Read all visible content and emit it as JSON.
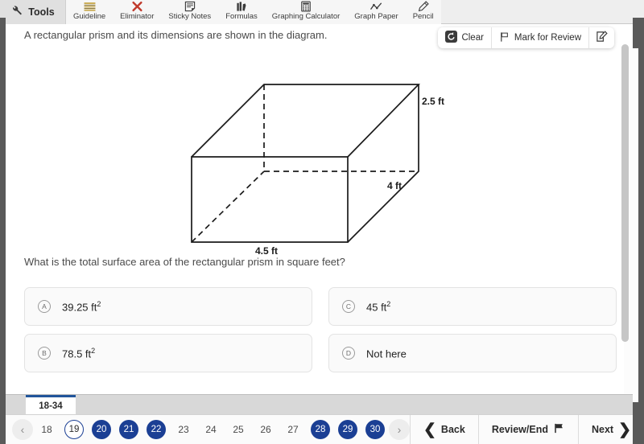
{
  "toolbar": {
    "tools_label": "Tools",
    "tools_icon": "wrench-icon",
    "items": [
      {
        "label": "Guideline",
        "icon": "guideline-icon"
      },
      {
        "label": "Eliminator",
        "icon": "eliminator-x-icon"
      },
      {
        "label": "Sticky Notes",
        "icon": "sticky-notes-icon"
      },
      {
        "label": "Formulas",
        "icon": "formulas-icon"
      },
      {
        "label": "Graphing Calculator",
        "icon": "calculator-icon"
      },
      {
        "label": "Graph Paper",
        "icon": "graph-paper-icon"
      },
      {
        "label": "Pencil",
        "icon": "pencil-icon"
      }
    ]
  },
  "actions": {
    "clear_label": "Clear",
    "clear_icon": "undo-circle-icon",
    "mark_label": "Mark for Review",
    "mark_icon": "flag-icon",
    "notes_icon": "note-edit-icon"
  },
  "question": {
    "stem": "A rectangular prism and its dimensions are shown in the diagram.",
    "prompt": "What is the total surface area of the rectangular prism in square feet?"
  },
  "diagram": {
    "type": "rectangular-prism",
    "labels": {
      "height": "2.5 ft",
      "depth": "4 ft",
      "width": "4.5 ft"
    }
  },
  "choices": [
    {
      "letter": "A",
      "value": "39.25 ft",
      "exponent": "2"
    },
    {
      "letter": "C",
      "value": "45 ft",
      "exponent": "2"
    },
    {
      "letter": "B",
      "value": "78.5 ft",
      "exponent": "2"
    },
    {
      "letter": "D",
      "value": "Not here",
      "exponent": ""
    }
  ],
  "tabs": {
    "active_label": "18-34"
  },
  "pagination": {
    "prev_icon": "chevron-left-icon",
    "next_icon": "chevron-right-icon",
    "pages": [
      {
        "n": "18",
        "state": "plain"
      },
      {
        "n": "19",
        "state": "current"
      },
      {
        "n": "20",
        "state": "filled"
      },
      {
        "n": "21",
        "state": "filled"
      },
      {
        "n": "22",
        "state": "filled"
      },
      {
        "n": "23",
        "state": "plain"
      },
      {
        "n": "24",
        "state": "plain"
      },
      {
        "n": "25",
        "state": "plain"
      },
      {
        "n": "26",
        "state": "plain"
      },
      {
        "n": "27",
        "state": "plain"
      },
      {
        "n": "28",
        "state": "filled"
      },
      {
        "n": "29",
        "state": "filled"
      },
      {
        "n": "30",
        "state": "filled"
      }
    ]
  },
  "nav": {
    "back_label": "Back",
    "review_label": "Review/End",
    "review_icon": "flag-icon",
    "next_label": "Next"
  },
  "colors": {
    "accent_blue": "#1b3f94",
    "tab_accent": "#21559b",
    "eliminator_red": "#c0392b",
    "guideline_gold": "#c8a84b"
  }
}
